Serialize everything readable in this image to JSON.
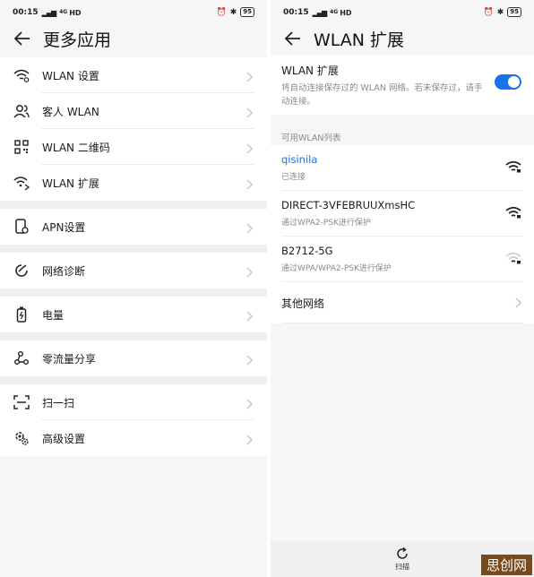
{
  "left": {
    "status": {
      "time": "00:15",
      "signal": "ᵢll",
      "net": "4G",
      "hd": "HD",
      "battery": "95"
    },
    "title": "更多应用",
    "groups": [
      [
        {
          "icon": "wifi-settings-icon",
          "label": "WLAN 设置"
        },
        {
          "icon": "guest-user-icon",
          "label": "客人 WLAN"
        },
        {
          "icon": "qrcode-icon",
          "label": "WLAN 二维码"
        },
        {
          "icon": "wifi-extend-icon",
          "label": "WLAN 扩展"
        }
      ],
      [
        {
          "icon": "apn-icon",
          "label": "APN设置"
        }
      ],
      [
        {
          "icon": "diagnose-icon",
          "label": "网络诊断"
        }
      ],
      [
        {
          "icon": "battery-icon",
          "label": "电量"
        }
      ],
      [
        {
          "icon": "share-icon",
          "label": "零流量分享"
        }
      ],
      [
        {
          "icon": "scan-icon",
          "label": "扫一扫"
        },
        {
          "icon": "advanced-settings-icon",
          "label": "高级设置"
        }
      ]
    ]
  },
  "right": {
    "status": {
      "time": "00:15",
      "signal": "ᵢll",
      "net": "4G",
      "hd": "HD",
      "battery": "95"
    },
    "title": "WLAN 扩展",
    "toggle": {
      "title": "WLAN 扩展",
      "desc": "将自动连接保存过的 WLAN 网络。若未保存过，请手动连接。",
      "on": true
    },
    "list_caption": "可用WLAN列表",
    "networks": [
      {
        "name": "qisinila",
        "sub": "已连接",
        "active": true,
        "strength": "full"
      },
      {
        "name": "DIRECT-3VFEBRUUXmsHC",
        "sub": "通过WPA2-PSK进行保护",
        "active": false,
        "strength": "full"
      },
      {
        "name": "B2712-5G",
        "sub": "通过WPA/WPA2-PSK进行保护",
        "active": false,
        "strength": "weak"
      }
    ],
    "other_networks": "其他网络",
    "scan_label": "扫描"
  },
  "watermark": "思创网",
  "colors": {
    "accent": "#1a73e8",
    "bg": "#f6f6f6"
  }
}
